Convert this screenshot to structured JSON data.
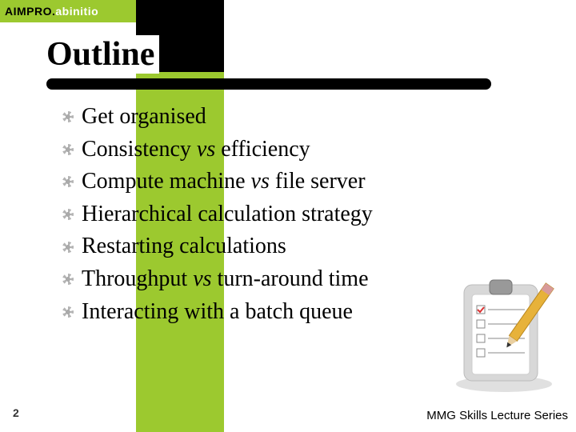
{
  "brand": {
    "primary": "AIMPRO",
    "dot": ".",
    "secondary": "abinitio"
  },
  "title": "Outline",
  "bullets": [
    {
      "pre": "Get organised",
      "vs": "",
      "post": ""
    },
    {
      "pre": "Consistency ",
      "vs": "vs",
      "post": " efficiency"
    },
    {
      "pre": "Compute machine ",
      "vs": "vs",
      "post": " file server"
    },
    {
      "pre": "Hierarchical calculation strategy",
      "vs": "",
      "post": ""
    },
    {
      "pre": "Restarting calculations",
      "vs": "",
      "post": ""
    },
    {
      "pre": "Throughput ",
      "vs": "vs",
      "post": " turn-around time"
    },
    {
      "pre": "Interacting with a batch queue",
      "vs": "",
      "post": ""
    }
  ],
  "page_number": "2",
  "series": "MMG Skills Lecture Series",
  "icons": {
    "bullet": "sun-icon",
    "clipart": "clipboard-pencil-icon"
  }
}
